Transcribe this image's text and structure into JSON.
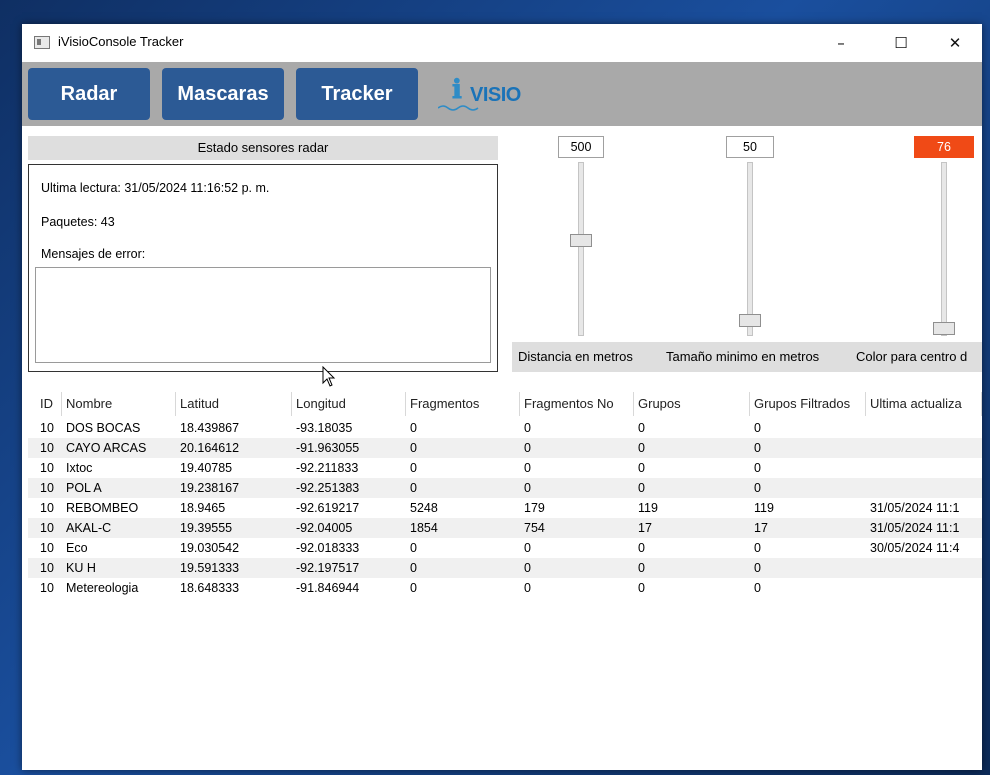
{
  "window": {
    "title": "iVisioConsole Tracker",
    "minimize": "–",
    "maximize": "☐",
    "close": "✕"
  },
  "toolbar": {
    "buttons": [
      "Radar",
      "Mascaras",
      "Tracker"
    ],
    "logo_text": "VISIO"
  },
  "status": {
    "header": "Estado sensores radar",
    "last_read": "Ultima lectura: 31/05/2024 11:16:52 p. m.",
    "packets": "Paquetes: 43",
    "errors_label": "Mensajes de error:"
  },
  "sliders": [
    {
      "value": "500",
      "label": "Distancia en metros",
      "level": 0.55,
      "value_color": "#ffffff"
    },
    {
      "value": "50",
      "label": "Tamaño minimo en metros",
      "level": 0.05,
      "value_color": "#ffffff"
    },
    {
      "value": "76",
      "label": "Color para centro d",
      "level": 0.0,
      "value_color": "#f04a16"
    }
  ],
  "table": {
    "columns": [
      "ID",
      "Nombre",
      "Latitud",
      "Longitud",
      "Fragmentos",
      "Fragmentos No",
      "Grupos",
      "Grupos Filtrados",
      "Ultima actualiza"
    ],
    "rows": [
      [
        "10",
        "DOS BOCAS",
        "18.439867",
        "-93.18035",
        "0",
        "0",
        "0",
        "0",
        ""
      ],
      [
        "10",
        "CAYO ARCAS",
        "20.164612",
        "-91.963055",
        "0",
        "0",
        "0",
        "0",
        ""
      ],
      [
        "10",
        "Ixtoc",
        "19.40785",
        "-92.211833",
        "0",
        "0",
        "0",
        "0",
        ""
      ],
      [
        "10",
        "POL A",
        "19.238167",
        "-92.251383",
        "0",
        "0",
        "0",
        "0",
        ""
      ],
      [
        "10",
        "REBOMBEO",
        "18.9465",
        "-92.619217",
        "5248",
        "179",
        "119",
        "119",
        "31/05/2024 11:1"
      ],
      [
        "10",
        "AKAL-C",
        "19.39555",
        "-92.04005",
        "1854",
        "754",
        "17",
        "17",
        "31/05/2024 11:1"
      ],
      [
        "10",
        "Eco",
        "19.030542",
        "-92.018333",
        "0",
        "0",
        "0",
        "0",
        "30/05/2024 11:4"
      ],
      [
        "10",
        "KU H",
        "19.591333",
        "-92.197517",
        "0",
        "0",
        "0",
        "0",
        ""
      ],
      [
        "10",
        "Metereologia",
        "18.648333",
        "-91.846944",
        "0",
        "0",
        "0",
        "0",
        ""
      ]
    ]
  }
}
